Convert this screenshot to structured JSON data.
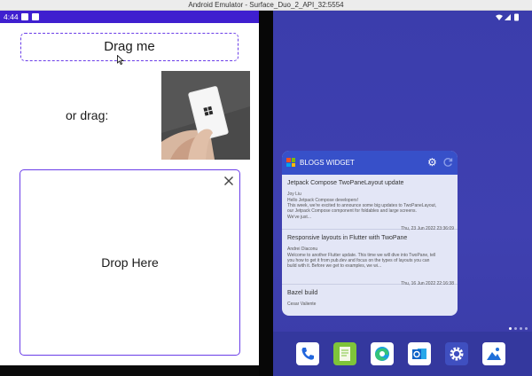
{
  "window": {
    "title": "Android Emulator - Surface_Duo_2_API_32:5554"
  },
  "status_bar": {
    "time": "4:44"
  },
  "left_pane": {
    "drag_label": "Drag me",
    "or_drag_label": "or drag:",
    "drop_label": "Drop Here"
  },
  "widget": {
    "title": "BLOGS WIDGET",
    "posts": [
      {
        "title": "Jetpack Compose TwoPaneLayout update",
        "author": "Joy Liu",
        "body": "Hello Jetpack Compose developers!\nThis week, we're excited to announce some big updates to TwoPaneLayout,\nour Jetpack Compose component for foldables and large screens.\nWe've just...",
        "date": "Thu, 23 Jun 2022 23:36:09"
      },
      {
        "title": "Responsive layouts in Flutter with TwoPane",
        "author": "Andrei Diaconu",
        "body": "Welcome to another Flutter update. This time we will dive into TwoPane, tell\nyou how to get it from pub.dev and focus on the types of layouts you can\nbuild with it. Before we get to examples, we wi...",
        "date": "Thu, 16 Jun 2022 22:16:38"
      },
      {
        "title": "Bazel build",
        "author": "Cesar Valiente",
        "body": "",
        "date": ""
      }
    ]
  },
  "dock": {
    "apps": [
      "phone-app-icon",
      "notes-app-icon",
      "edge-app-icon",
      "outlook-app-icon",
      "settings-app-icon",
      "gallery-app-icon"
    ]
  },
  "colors": {
    "accent": "#6a3de8",
    "status_bar": "#3f1fcf",
    "widget_header": "#3750c9",
    "launcher_bg": "#3f40b0"
  }
}
